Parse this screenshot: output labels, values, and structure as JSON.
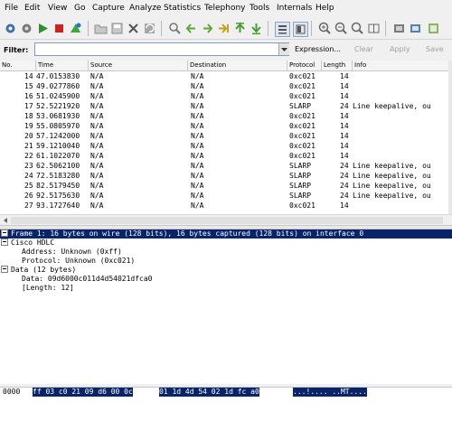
{
  "menu": [
    "File",
    "Edit",
    "View",
    "Go",
    "Capture",
    "Analyze",
    "Statistics",
    "Telephony",
    "Tools",
    "Internals",
    "Help"
  ],
  "filter": {
    "label": "Filter:",
    "value": "",
    "expression": "Expression...",
    "clear": "Clear",
    "apply": "Apply",
    "save": "Save"
  },
  "columns": [
    "No.",
    "Time",
    "Source",
    "Destination",
    "Protocol",
    "Length",
    "Info"
  ],
  "packets": [
    {
      "no": "14",
      "time": "47.0153830",
      "src": "N/A",
      "dst": "N/A",
      "proto": "0xc021",
      "len": "14",
      "info": ""
    },
    {
      "no": "15",
      "time": "49.0277860",
      "src": "N/A",
      "dst": "N/A",
      "proto": "0xc021",
      "len": "14",
      "info": ""
    },
    {
      "no": "16",
      "time": "51.0245900",
      "src": "N/A",
      "dst": "N/A",
      "proto": "0xc021",
      "len": "14",
      "info": ""
    },
    {
      "no": "17",
      "time": "52.5221920",
      "src": "N/A",
      "dst": "N/A",
      "proto": "SLARP",
      "len": "24",
      "info": "Line keepalive, ou"
    },
    {
      "no": "18",
      "time": "53.0681930",
      "src": "N/A",
      "dst": "N/A",
      "proto": "0xc021",
      "len": "14",
      "info": ""
    },
    {
      "no": "19",
      "time": "55.0805970",
      "src": "N/A",
      "dst": "N/A",
      "proto": "0xc021",
      "len": "14",
      "info": ""
    },
    {
      "no": "20",
      "time": "57.1242000",
      "src": "N/A",
      "dst": "N/A",
      "proto": "0xc021",
      "len": "14",
      "info": ""
    },
    {
      "no": "21",
      "time": "59.1210040",
      "src": "N/A",
      "dst": "N/A",
      "proto": "0xc021",
      "len": "14",
      "info": ""
    },
    {
      "no": "22",
      "time": "61.1022070",
      "src": "N/A",
      "dst": "N/A",
      "proto": "0xc021",
      "len": "14",
      "info": ""
    },
    {
      "no": "23",
      "time": "62.5062100",
      "src": "N/A",
      "dst": "N/A",
      "proto": "SLARP",
      "len": "24",
      "info": "Line keepalive, ou"
    },
    {
      "no": "24",
      "time": "72.5183280",
      "src": "N/A",
      "dst": "N/A",
      "proto": "SLARP",
      "len": "24",
      "info": "Line keepalive, ou"
    },
    {
      "no": "25",
      "time": "82.5179450",
      "src": "N/A",
      "dst": "N/A",
      "proto": "SLARP",
      "len": "24",
      "info": "Line keepalive, ou"
    },
    {
      "no": "26",
      "time": "92.5175630",
      "src": "N/A",
      "dst": "N/A",
      "proto": "SLARP",
      "len": "24",
      "info": "Line keepalive, ou"
    },
    {
      "no": "27",
      "time": "93.1727640",
      "src": "N/A",
      "dst": "N/A",
      "proto": "0xc021",
      "len": "14",
      "info": ""
    }
  ],
  "details": [
    {
      "text": "Frame 1: 16 bytes on wire (128 bits), 16 bytes captured (128 bits) on interface 0",
      "expander": true,
      "indent": 0,
      "selected": true
    },
    {
      "text": "Cisco HDLC",
      "expander": true,
      "indent": 0,
      "selected": false
    },
    {
      "text": "Address: Unknown (0xff)",
      "expander": false,
      "indent": 1,
      "selected": false
    },
    {
      "text": "Protocol: Unknown (0xc021)",
      "expander": false,
      "indent": 1,
      "selected": false
    },
    {
      "text": "Data (12 bytes)",
      "expander": true,
      "indent": 0,
      "selected": false
    },
    {
      "text": "Data: 09d6000c011d4d54021dfca0",
      "expander": false,
      "indent": 1,
      "selected": false
    },
    {
      "text": "[Length: 12]",
      "expander": false,
      "indent": 1,
      "selected": false
    }
  ],
  "bytes": {
    "offset": "0000",
    "hex1": "ff 03 c0 21 09 d6 00 0c",
    "hex2": "01 1d 4d 54 02 1d fc a0",
    "ascii": "...!.... ..MT...."
  }
}
